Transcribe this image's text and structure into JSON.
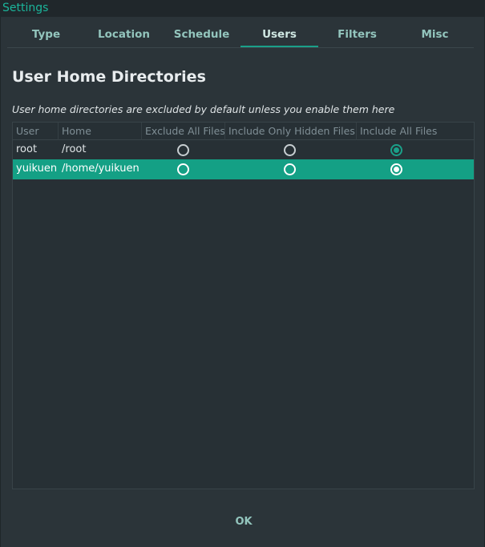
{
  "window": {
    "title": "Settings"
  },
  "tabs": [
    {
      "label": "Type"
    },
    {
      "label": "Location"
    },
    {
      "label": "Schedule"
    },
    {
      "label": "Users",
      "active": true
    },
    {
      "label": "Filters"
    },
    {
      "label": "Misc"
    }
  ],
  "section": {
    "title": "User Home Directories",
    "note": "User home directories are excluded by default unless you enable them here"
  },
  "table": {
    "columns": [
      "User",
      "Home",
      "Exclude All Files",
      "Include Only Hidden Files",
      "Include All Files"
    ],
    "rows": [
      {
        "user": "root",
        "home": "/root",
        "selected_option": "Include All Files",
        "selected": false
      },
      {
        "user": "yuikuen",
        "home": "/home/yuikuen",
        "selected_option": "Include All Files",
        "selected": true
      }
    ]
  },
  "footer": {
    "ok_label": "OK"
  },
  "colors": {
    "accent": "#1aa089",
    "title": "#1bb59b",
    "selected_row": "#14a085",
    "background": "#2b3439"
  }
}
